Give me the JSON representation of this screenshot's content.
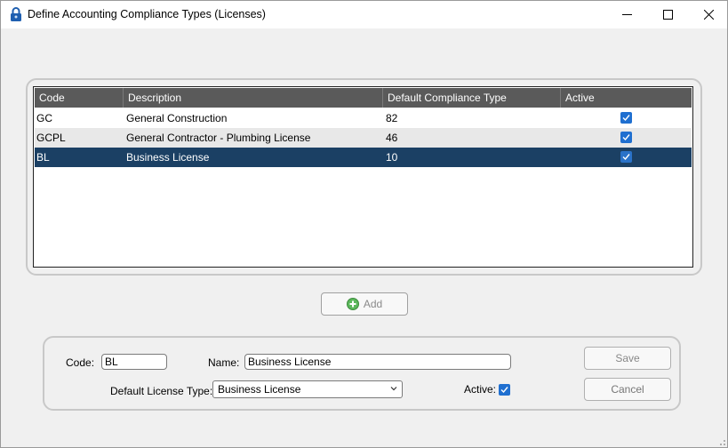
{
  "window": {
    "title": "Define Accounting Compliance Types (Licenses)",
    "icon": "lock-icon"
  },
  "grid": {
    "columns": [
      "Code",
      "Description",
      "Default Compliance Type",
      "Active"
    ],
    "rows": [
      {
        "code": "GC",
        "description": "General Construction",
        "default_compliance_type": "82",
        "active": true,
        "selected": false
      },
      {
        "code": "GCPL",
        "description": "General Contractor - Plumbing License",
        "default_compliance_type": "46",
        "active": true,
        "selected": false
      },
      {
        "code": "BL",
        "description": "Business License",
        "default_compliance_type": "10",
        "active": true,
        "selected": true
      }
    ],
    "colors": {
      "header_bg": "#5a5a5a",
      "selected_bg": "#1b4064",
      "alt_row_bg": "#e8e8e8"
    }
  },
  "add_button": {
    "label": "Add",
    "icon": "plus-circle-icon"
  },
  "form": {
    "code_label": "Code:",
    "code_value": "BL",
    "name_label": "Name:",
    "name_value": "Business License",
    "license_type_label": "Default License Type:",
    "license_type_value": "Business License",
    "active_label": "Active:",
    "active_checked": true,
    "save_label": "Save",
    "cancel_label": "Cancel"
  },
  "colors": {
    "accent": "#1f6fd0",
    "add_icon_green": "#4caf50"
  }
}
